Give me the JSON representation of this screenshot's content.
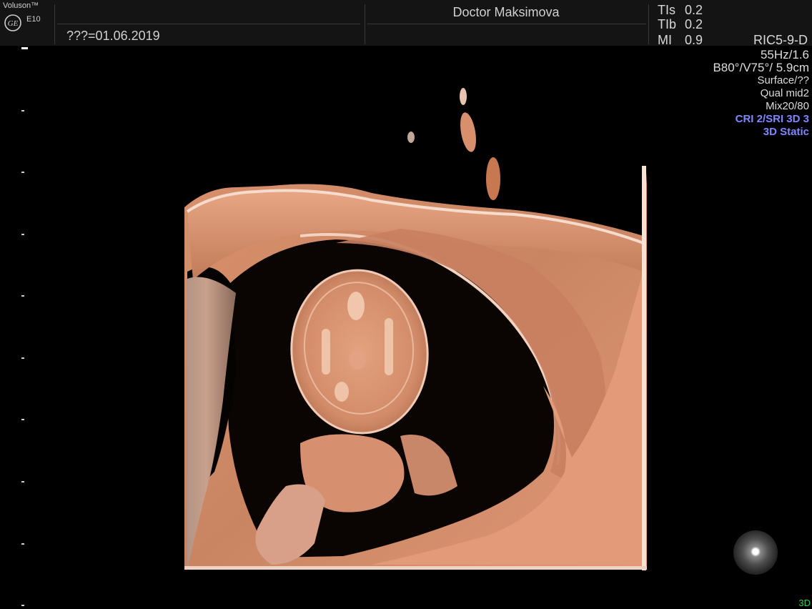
{
  "header": {
    "brand": "Voluson™",
    "model": "E10",
    "logo": "ge-logo-icon",
    "patient_date": "???=01.06.2019",
    "operator": "Doctor Maksimova"
  },
  "safety": [
    {
      "label": "TIs",
      "value": "0.2"
    },
    {
      "label": "TIb",
      "value": "0.2"
    },
    {
      "label": "MI",
      "value": "0.9"
    }
  ],
  "probe": "RIC5-9-D",
  "params": {
    "frame": "55Hz/1.6",
    "angles": "B80°/V75°/ 5.9cm",
    "render_mode": "Surface/??",
    "quality": "Qual mid2",
    "mix": "Mix20/80",
    "cri": "CRI 2/SRI 3D 3",
    "acquisition": "3D Static"
  },
  "mode_indicator": "3D",
  "orientation_widget": "orientation-sphere-icon",
  "colors": {
    "background": "#000000",
    "header": "#141414",
    "accent_blue": "#7f87ff",
    "mode_green": "#2fcf4a",
    "render_skin": "#d98c68"
  }
}
